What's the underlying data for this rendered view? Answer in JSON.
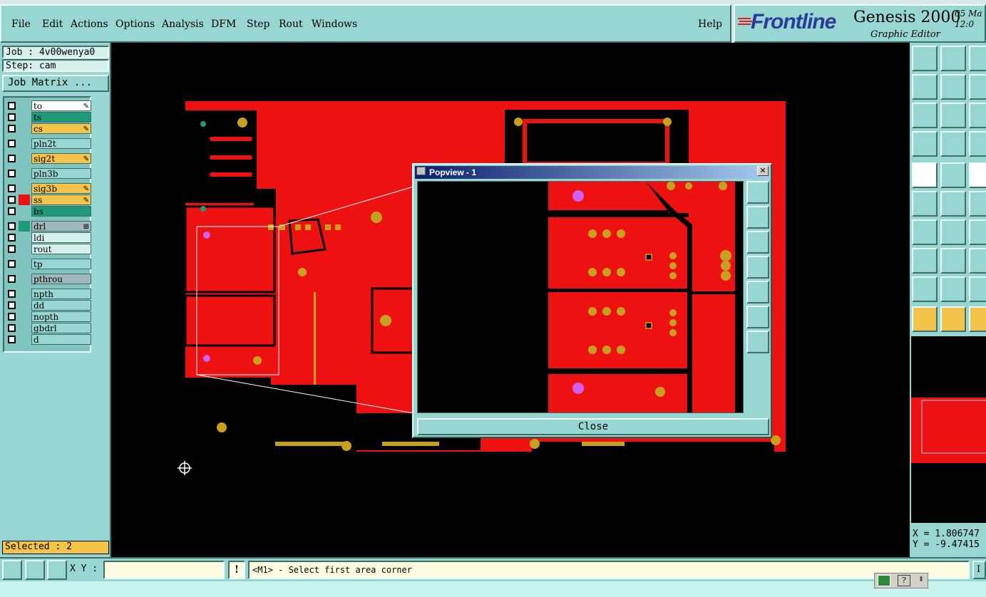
{
  "menu": {
    "items": [
      "File",
      "Edit",
      "Actions",
      "Options",
      "Analysis",
      "DFM",
      "Step",
      "Rout",
      "Windows"
    ],
    "help": "Help"
  },
  "brand": {
    "logo": "Frontline",
    "product": "Genesis 2000",
    "subtitle": "Graphic Editor",
    "date_line1": "05 Ma",
    "date_line2": "12:0"
  },
  "job": {
    "job_label": "Job : 4v00wenya0",
    "step_label": "Step: cam",
    "matrix_button": "Job Matrix ..."
  },
  "layers": [
    {
      "name": "to",
      "color": "#ffffff",
      "swatch": "",
      "mark": "✎"
    },
    {
      "name": "ts",
      "color": "#1e9a78",
      "swatch": "",
      "mark": ""
    },
    {
      "name": "cs",
      "color": "#f4c54a",
      "swatch": "",
      "mark": "✎"
    },
    {
      "name": "pln2t",
      "color": "#98d6d2",
      "swatch": "",
      "mark": ""
    },
    {
      "name": "sig2t",
      "color": "#f4c54a",
      "swatch": "",
      "mark": "✎"
    },
    {
      "name": "pln3b",
      "color": "#98d6d2",
      "swatch": "",
      "mark": ""
    },
    {
      "name": "sig3b",
      "color": "#f4c54a",
      "swatch": "",
      "mark": "✎"
    },
    {
      "name": "ss",
      "color": "#f4c54a",
      "swatch": "#ee1111",
      "mark": "✎"
    },
    {
      "name": "bs",
      "color": "#1e9a78",
      "swatch": "",
      "mark": ""
    },
    {
      "name": "drl",
      "color": "#a0b8bc",
      "swatch": "#1e9a78",
      "mark": "⊞"
    },
    {
      "name": "ldi",
      "color": "#d8f0ec",
      "swatch": "",
      "mark": ""
    },
    {
      "name": "rout",
      "color": "#d8f0ec",
      "swatch": "",
      "mark": ""
    },
    {
      "name": "tp",
      "color": "#98d6d2",
      "swatch": "",
      "mark": ""
    },
    {
      "name": "pthrou",
      "color": "#a0b8bc",
      "swatch": "",
      "mark": ""
    },
    {
      "name": "npth",
      "color": "#98d6d2",
      "swatch": "",
      "mark": ""
    },
    {
      "name": "dd",
      "color": "#98d6d2",
      "swatch": "",
      "mark": ""
    },
    {
      "name": "nopth",
      "color": "#98d6d2",
      "swatch": "",
      "mark": ""
    },
    {
      "name": "gbdrl",
      "color": "#98d6d2",
      "swatch": "",
      "mark": ""
    },
    {
      "name": "d",
      "color": "#98d6d2",
      "swatch": "",
      "mark": ""
    }
  ],
  "selected": "Selected : 2",
  "popview": {
    "title": "Popview - 1",
    "close": "Close"
  },
  "coords": {
    "x": "X = 1.806747",
    "y": "Y = -9.47415"
  },
  "bottom": {
    "xy_label": "X Y :",
    "xy_value": "",
    "excl": "!",
    "status": "<M1> - Select first area corner",
    "right_button": "I"
  },
  "colors": {
    "copper": "#ee1111",
    "pad": "#c8a020",
    "via_pink": "#d060f0",
    "panel": "#98d6d2"
  }
}
